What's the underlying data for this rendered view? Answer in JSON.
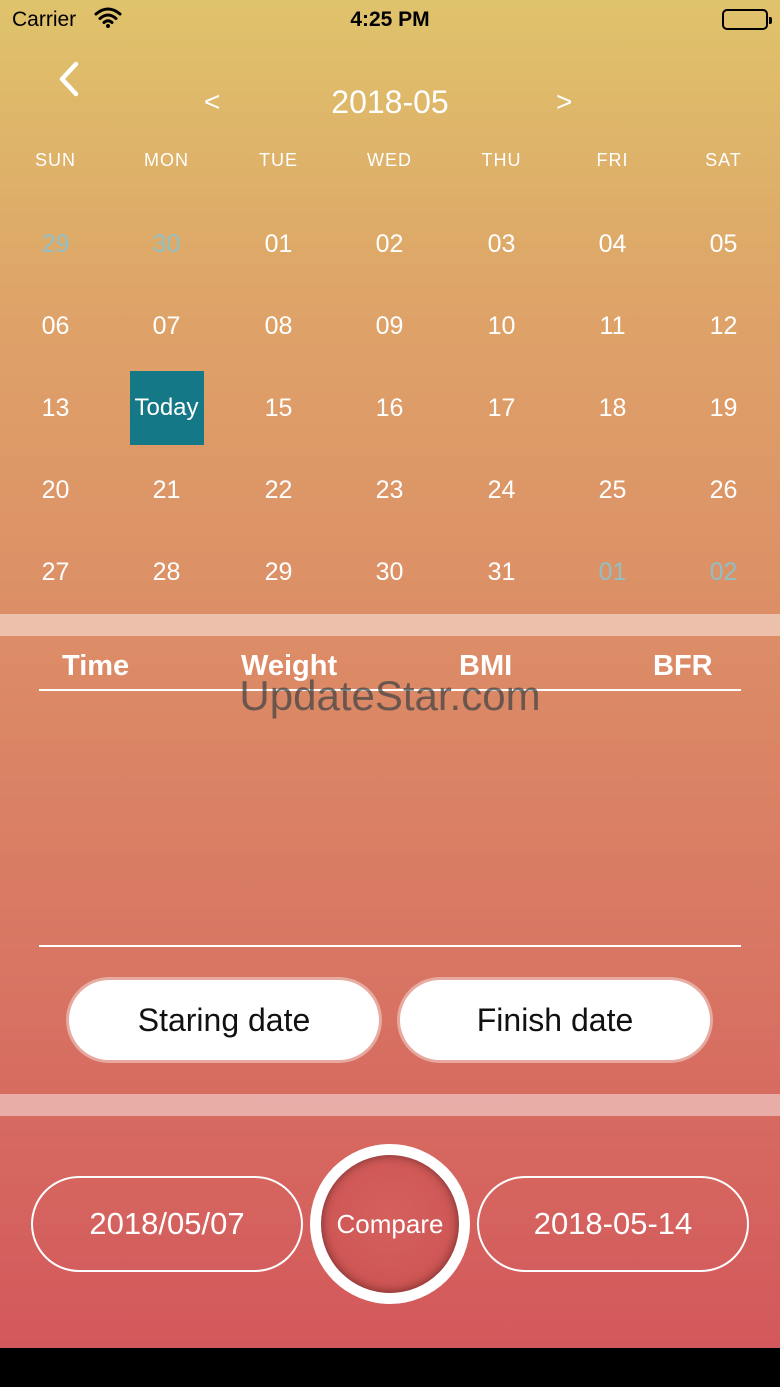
{
  "status_bar": {
    "carrier": "Carrier",
    "time": "4:25 PM"
  },
  "calendar": {
    "prev_label": "<",
    "next_label": ">",
    "month_title": "2018-05",
    "weekdays": [
      "SUN",
      "MON",
      "TUE",
      "WED",
      "THU",
      "FRI",
      "SAT"
    ],
    "weeks": [
      [
        "29",
        "30",
        "01",
        "02",
        "03",
        "04",
        "05"
      ],
      [
        "06",
        "07",
        "08",
        "09",
        "10",
        "11",
        "12"
      ],
      [
        "13",
        "Today",
        "15",
        "16",
        "17",
        "18",
        "19"
      ],
      [
        "20",
        "21",
        "22",
        "23",
        "24",
        "25",
        "26"
      ],
      [
        "27",
        "28",
        "29",
        "30",
        "31",
        "01",
        "02"
      ]
    ],
    "muted_color": "#8fc0c6",
    "today_color": "#157886"
  },
  "table": {
    "headers": [
      "Time",
      "Weight",
      "BMI",
      "BFR"
    ]
  },
  "watermark": "UpdateStar.com",
  "buttons": {
    "start_label": "Staring date",
    "finish_label": "Finish date"
  },
  "compare": {
    "start_date": "2018/05/07",
    "compare_label": "Compare",
    "end_date": "2018-05-14"
  },
  "colors": {
    "gradient_top": "#dfc36b",
    "gradient_bottom": "#d3585b"
  },
  "icons": {
    "back": "chevron-left-icon",
    "wifi": "wifi-icon",
    "battery": "battery-icon"
  }
}
